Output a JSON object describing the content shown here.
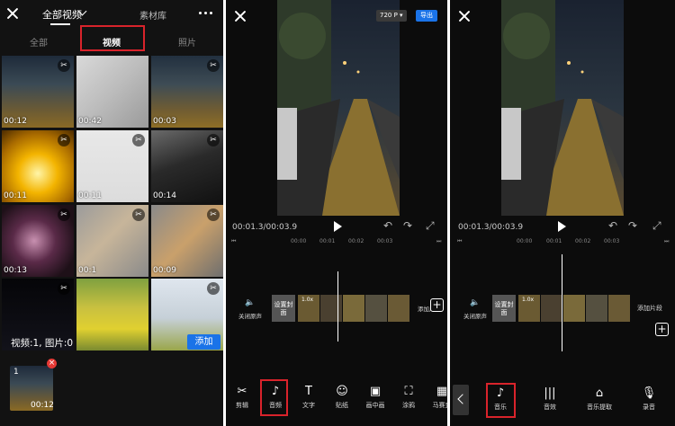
{
  "panel1": {
    "title": "全部视频",
    "library": "素材库",
    "tabs": [
      "全部",
      "视频",
      "照片"
    ],
    "cells": [
      {
        "dur": "00:12",
        "scissors": true,
        "bg": "linear-gradient(180deg,#1e2a3a 0%,#3b4a55 40%,#6a5a35 75%,#8a6a25 100%)"
      },
      {
        "dur": "00:42",
        "scissors": false,
        "bg": "linear-gradient(135deg,#d9d9d9 0%,#bcbcbc 50%,#9a9a9a 100%)"
      },
      {
        "dur": "00:03",
        "scissors": true,
        "bg": "linear-gradient(180deg,#22303f 0%,#3e4c55 40%,#6f5c33 75%,#8e6e26 100%)"
      },
      {
        "dur": "00:11",
        "scissors": true,
        "bg": "radial-gradient(circle at 50% 60%,#fff5a8 0%,#f3b400 35%,#a86a00 70%,#4a2a00 100%)"
      },
      {
        "dur": "00:11",
        "scissors": true,
        "bg": "linear-gradient(180deg,#e8e8e8 0%,#dcdcdc 100%)"
      },
      {
        "dur": "00:14",
        "scissors": true,
        "bg": "linear-gradient(160deg,#6a6a6a 0%,#2a2a2a 45%,#111 100%)"
      },
      {
        "dur": "00:13",
        "scissors": true,
        "bg": "radial-gradient(circle at 45% 50%,#c890b0 0%,#5a2a48 40%,#1e1018 80%)"
      },
      {
        "dur": "00:1",
        "scissors": true,
        "bg": "linear-gradient(135deg,#9b9b9b 0%,#c7b59a 45%,#8a8a8a 100%)"
      },
      {
        "dur": "00:09",
        "scissors": true,
        "bg": "linear-gradient(135deg,#8a8a8a 0%,#c9a06b 50%,#6e6e6e 100%)"
      },
      {
        "dur": "",
        "scissors": true,
        "bg": "linear-gradient(180deg,#050508 0%,#12121a 100%)"
      },
      {
        "dur": "",
        "scissors": false,
        "bg": "linear-gradient(180deg,#7fa040 0%,#c8c040 40%,#e0d030 70%,#7a8a30 100%)"
      },
      {
        "dur": "",
        "scissors": true,
        "bg": "linear-gradient(180deg,#dfe6ee 0%,#c6d0d8 55%,#9aa64a 100%)"
      }
    ],
    "count_text": "视频:1, 图片:0",
    "add_label": "添加",
    "selected_num": "1",
    "selected_dur": "00:12"
  },
  "panel2": {
    "resolution": "720 P ▾",
    "export": "导出",
    "timecode": "00:01.3/00:03.9",
    "ruler": [
      "00:00",
      "00:01",
      "00:02",
      "00:03"
    ],
    "mute_label": "关闭原声",
    "cover_label": "设置封面",
    "speed": "1.0x",
    "add_clip_label": "添加片",
    "tools": [
      {
        "icon": "✂",
        "label": "剪辑"
      },
      {
        "icon": "♪",
        "label": "音频"
      },
      {
        "icon": "T",
        "label": "文字"
      },
      {
        "icon": "☺",
        "label": "贴纸"
      },
      {
        "icon": "▣",
        "label": "画中画"
      },
      {
        "icon": "⛶",
        "label": "涂鸦"
      },
      {
        "icon": "▦",
        "label": "马赛克"
      }
    ]
  },
  "panel3": {
    "timecode": "00:01.3/00:03.9",
    "ruler": [
      "00:00",
      "00:01",
      "00:02",
      "00:03"
    ],
    "mute_label": "关闭原声",
    "cover_label": "设置封面",
    "speed": "1.0x",
    "add_clip_label": "添加片段",
    "tools": [
      {
        "icon": "♪",
        "label": "音乐"
      },
      {
        "icon": "|||",
        "label": "音效"
      },
      {
        "icon": "⌂",
        "label": "音乐提取"
      },
      {
        "icon": "🎙",
        "label": "录音"
      }
    ]
  },
  "colors": {
    "accent_blue": "#1a73e8",
    "highlight_red": "#d9232b",
    "delete_red": "#e53935"
  }
}
